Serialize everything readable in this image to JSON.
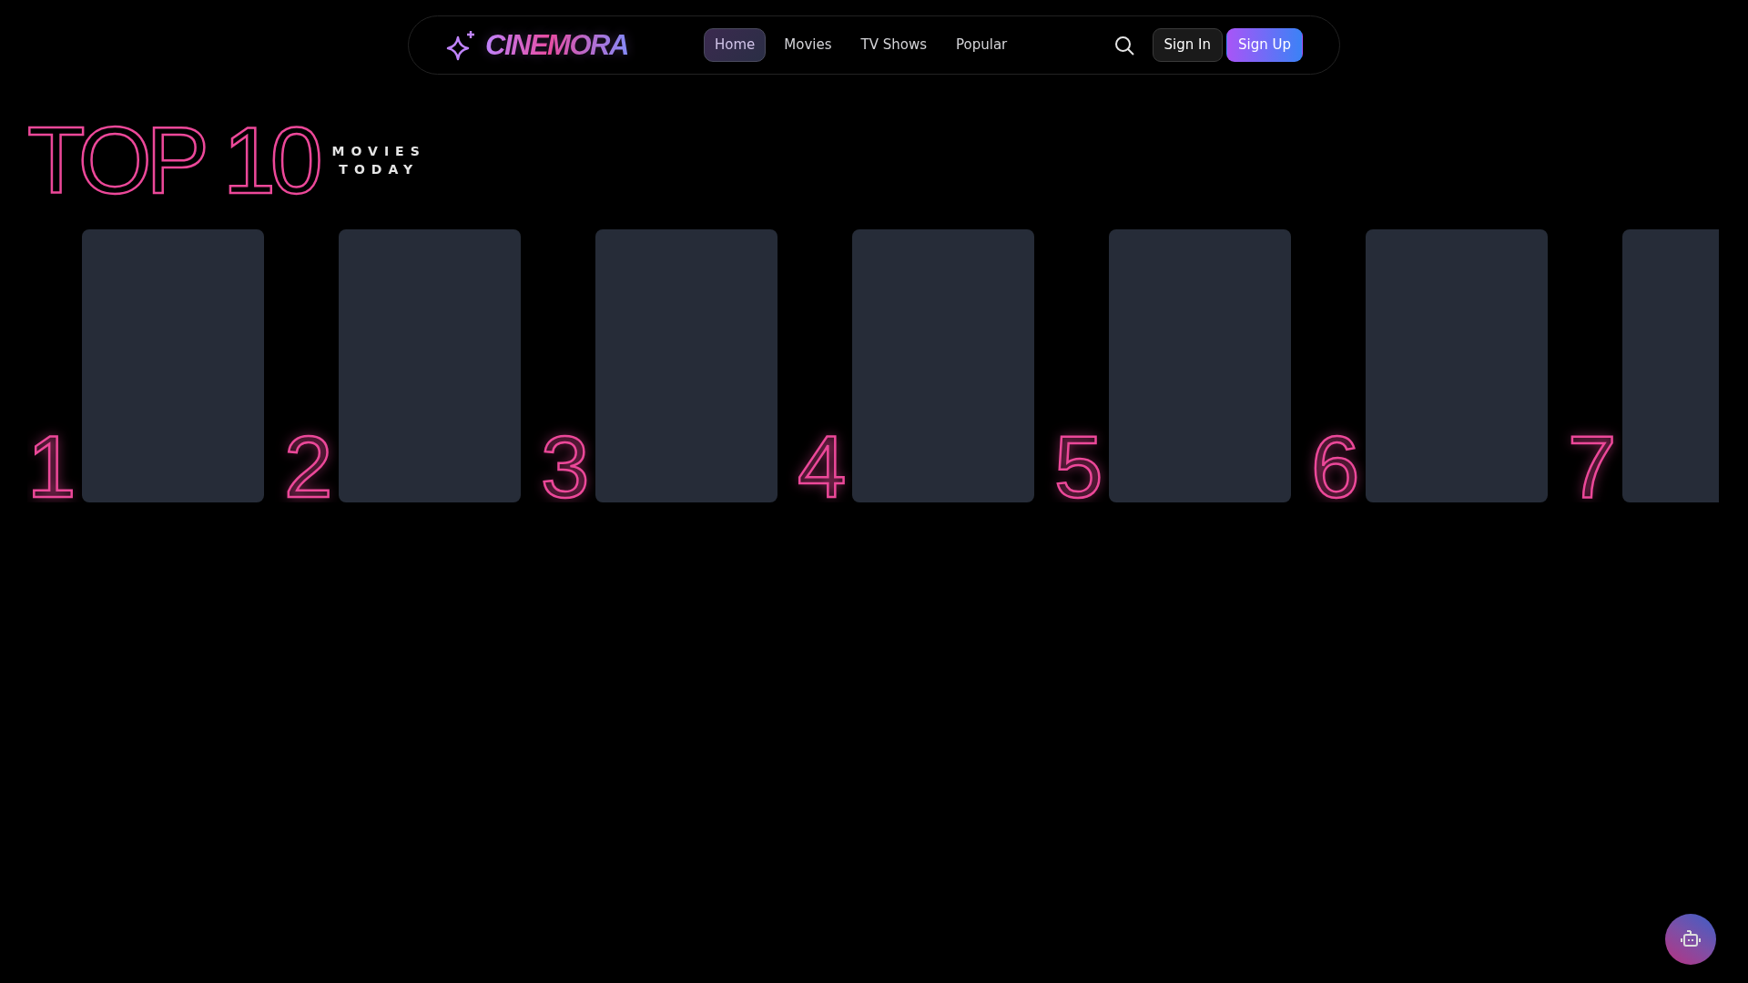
{
  "header": {
    "brand": "CINEMORA",
    "nav": [
      {
        "label": "Home",
        "selected": true
      },
      {
        "label": "Movies",
        "selected": false
      },
      {
        "label": "TV Shows",
        "selected": false
      },
      {
        "label": "Popular",
        "selected": false
      }
    ],
    "buttons": [
      {
        "kind": "outline",
        "label": "Sign In"
      },
      {
        "kind": "gradient",
        "label": "Sign Up"
      }
    ]
  },
  "heading": {
    "title": "TOP 10",
    "subtitle": [
      "MOVIES",
      "TODAY"
    ]
  },
  "ranking": [
    {
      "rank": "1"
    },
    {
      "rank": "2"
    },
    {
      "rank": "3"
    },
    {
      "rank": "4"
    },
    {
      "rank": "5"
    },
    {
      "rank": "6"
    },
    {
      "rank": "7"
    }
  ]
}
